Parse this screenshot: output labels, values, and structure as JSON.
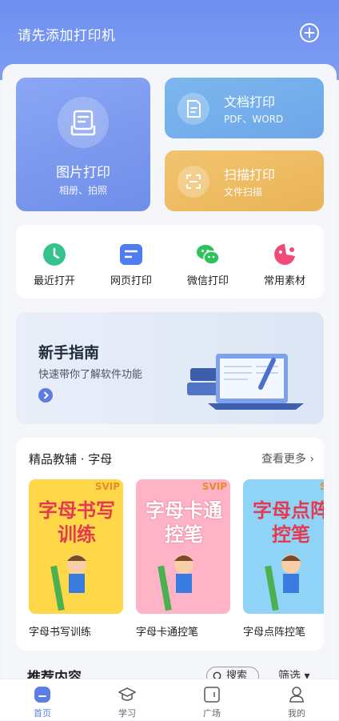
{
  "header": {
    "title": "请先添加打印机",
    "add_icon": "plus-circle-icon"
  },
  "cards": {
    "image_print": {
      "title": "图片打印",
      "subtitle": "相册、拍照"
    },
    "doc_print": {
      "title": "文档打印",
      "subtitle": "PDF、WORD"
    },
    "scan_print": {
      "title": "扫描打印",
      "subtitle": "文件扫描"
    }
  },
  "quick": [
    {
      "label": "最近打开",
      "icon": "clock-icon"
    },
    {
      "label": "网页打印",
      "icon": "webpage-icon"
    },
    {
      "label": "微信打印",
      "icon": "wechat-icon"
    },
    {
      "label": "常用素材",
      "icon": "material-icon"
    }
  ],
  "guide": {
    "title": "新手指南",
    "subtitle": "快速带你了解软件功能"
  },
  "course": {
    "title": "精品教辅 · 字母",
    "more": "查看更多",
    "books": [
      {
        "label": "字母书写训练",
        "cover_title": "字母书写训练",
        "badge": "SVIP",
        "color": "#ffd84a"
      },
      {
        "label": "字母卡通控笔",
        "cover_title": "字母卡通控笔",
        "badge": "SVIP",
        "color": "#ffb3c7"
      },
      {
        "label": "字母点阵控笔",
        "cover_title": "字母点阵控笔",
        "badge": "SV",
        "color": "#8fd3f7"
      }
    ]
  },
  "recommend": {
    "title": "推荐内容",
    "search": "搜索",
    "filter": "筛选"
  },
  "tabbar": [
    {
      "label": "首页",
      "active": true
    },
    {
      "label": "学习",
      "active": false
    },
    {
      "label": "广场",
      "active": false
    },
    {
      "label": "我的",
      "active": false
    }
  ],
  "colors": {
    "primary": "#6e8ff0",
    "doc": "#7cb7ef",
    "scan": "#f2c46f"
  }
}
